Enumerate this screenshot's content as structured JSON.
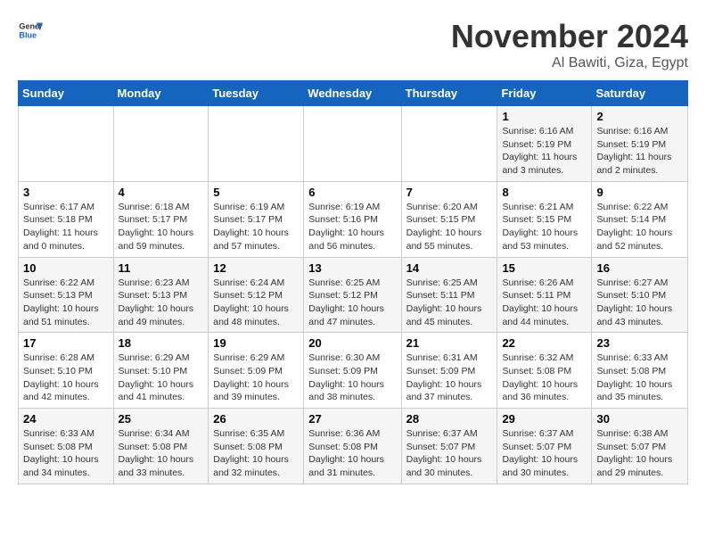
{
  "header": {
    "logo_line1": "General",
    "logo_line2": "Blue",
    "month_title": "November 2024",
    "location": "Al Bawiti, Giza, Egypt"
  },
  "weekdays": [
    "Sunday",
    "Monday",
    "Tuesday",
    "Wednesday",
    "Thursday",
    "Friday",
    "Saturday"
  ],
  "weeks": [
    [
      {
        "day": "",
        "info": ""
      },
      {
        "day": "",
        "info": ""
      },
      {
        "day": "",
        "info": ""
      },
      {
        "day": "",
        "info": ""
      },
      {
        "day": "",
        "info": ""
      },
      {
        "day": "1",
        "info": "Sunrise: 6:16 AM\nSunset: 5:19 PM\nDaylight: 11 hours and 3 minutes."
      },
      {
        "day": "2",
        "info": "Sunrise: 6:16 AM\nSunset: 5:19 PM\nDaylight: 11 hours and 2 minutes."
      }
    ],
    [
      {
        "day": "3",
        "info": "Sunrise: 6:17 AM\nSunset: 5:18 PM\nDaylight: 11 hours and 0 minutes."
      },
      {
        "day": "4",
        "info": "Sunrise: 6:18 AM\nSunset: 5:17 PM\nDaylight: 10 hours and 59 minutes."
      },
      {
        "day": "5",
        "info": "Sunrise: 6:19 AM\nSunset: 5:17 PM\nDaylight: 10 hours and 57 minutes."
      },
      {
        "day": "6",
        "info": "Sunrise: 6:19 AM\nSunset: 5:16 PM\nDaylight: 10 hours and 56 minutes."
      },
      {
        "day": "7",
        "info": "Sunrise: 6:20 AM\nSunset: 5:15 PM\nDaylight: 10 hours and 55 minutes."
      },
      {
        "day": "8",
        "info": "Sunrise: 6:21 AM\nSunset: 5:15 PM\nDaylight: 10 hours and 53 minutes."
      },
      {
        "day": "9",
        "info": "Sunrise: 6:22 AM\nSunset: 5:14 PM\nDaylight: 10 hours and 52 minutes."
      }
    ],
    [
      {
        "day": "10",
        "info": "Sunrise: 6:22 AM\nSunset: 5:13 PM\nDaylight: 10 hours and 51 minutes."
      },
      {
        "day": "11",
        "info": "Sunrise: 6:23 AM\nSunset: 5:13 PM\nDaylight: 10 hours and 49 minutes."
      },
      {
        "day": "12",
        "info": "Sunrise: 6:24 AM\nSunset: 5:12 PM\nDaylight: 10 hours and 48 minutes."
      },
      {
        "day": "13",
        "info": "Sunrise: 6:25 AM\nSunset: 5:12 PM\nDaylight: 10 hours and 47 minutes."
      },
      {
        "day": "14",
        "info": "Sunrise: 6:25 AM\nSunset: 5:11 PM\nDaylight: 10 hours and 45 minutes."
      },
      {
        "day": "15",
        "info": "Sunrise: 6:26 AM\nSunset: 5:11 PM\nDaylight: 10 hours and 44 minutes."
      },
      {
        "day": "16",
        "info": "Sunrise: 6:27 AM\nSunset: 5:10 PM\nDaylight: 10 hours and 43 minutes."
      }
    ],
    [
      {
        "day": "17",
        "info": "Sunrise: 6:28 AM\nSunset: 5:10 PM\nDaylight: 10 hours and 42 minutes."
      },
      {
        "day": "18",
        "info": "Sunrise: 6:29 AM\nSunset: 5:10 PM\nDaylight: 10 hours and 41 minutes."
      },
      {
        "day": "19",
        "info": "Sunrise: 6:29 AM\nSunset: 5:09 PM\nDaylight: 10 hours and 39 minutes."
      },
      {
        "day": "20",
        "info": "Sunrise: 6:30 AM\nSunset: 5:09 PM\nDaylight: 10 hours and 38 minutes."
      },
      {
        "day": "21",
        "info": "Sunrise: 6:31 AM\nSunset: 5:09 PM\nDaylight: 10 hours and 37 minutes."
      },
      {
        "day": "22",
        "info": "Sunrise: 6:32 AM\nSunset: 5:08 PM\nDaylight: 10 hours and 36 minutes."
      },
      {
        "day": "23",
        "info": "Sunrise: 6:33 AM\nSunset: 5:08 PM\nDaylight: 10 hours and 35 minutes."
      }
    ],
    [
      {
        "day": "24",
        "info": "Sunrise: 6:33 AM\nSunset: 5:08 PM\nDaylight: 10 hours and 34 minutes."
      },
      {
        "day": "25",
        "info": "Sunrise: 6:34 AM\nSunset: 5:08 PM\nDaylight: 10 hours and 33 minutes."
      },
      {
        "day": "26",
        "info": "Sunrise: 6:35 AM\nSunset: 5:08 PM\nDaylight: 10 hours and 32 minutes."
      },
      {
        "day": "27",
        "info": "Sunrise: 6:36 AM\nSunset: 5:08 PM\nDaylight: 10 hours and 31 minutes."
      },
      {
        "day": "28",
        "info": "Sunrise: 6:37 AM\nSunset: 5:07 PM\nDaylight: 10 hours and 30 minutes."
      },
      {
        "day": "29",
        "info": "Sunrise: 6:37 AM\nSunset: 5:07 PM\nDaylight: 10 hours and 30 minutes."
      },
      {
        "day": "30",
        "info": "Sunrise: 6:38 AM\nSunset: 5:07 PM\nDaylight: 10 hours and 29 minutes."
      }
    ]
  ]
}
